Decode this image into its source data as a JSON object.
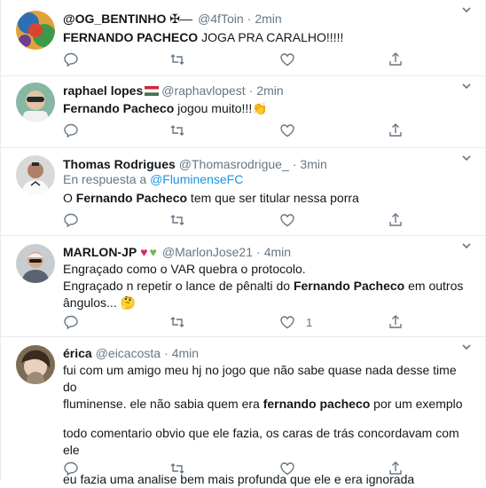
{
  "tweets": [
    {
      "name": "@OG_BENTINHO",
      "name_suffix": "✠—",
      "handle": "@4fToin",
      "time": "2min",
      "body_bold": "FERNANDO PACHECO",
      "body_rest": " JOGA PRA CARALHO!!!!!",
      "like_count": ""
    },
    {
      "name": "raphael lopes",
      "handle": "@raphavlopest",
      "time": "2min",
      "body_bold": "Fernando Pacheco",
      "body_rest": " jogou muito!!!",
      "body_emoji": "👏",
      "like_count": ""
    },
    {
      "name": "Thomas Rodrigues",
      "handle": "@Thomasrodrigue_",
      "time": "3min",
      "reply_prefix": "En respuesta a",
      "reply_to": "@FluminenseFC",
      "body_pre": "O ",
      "body_bold": "Fernando Pacheco",
      "body_rest": " tem que ser titular nessa porra",
      "like_count": ""
    },
    {
      "name": "MARLON-JP",
      "handle": "@MarlonJose21",
      "time": "4min",
      "line1": "Engraçado como o VAR quebra o protocolo.",
      "line2_pre": "Engraçado n repetir o lance de pênalti do ",
      "line2_bold": "Fernando Pacheco",
      "line2_rest": " em outros",
      "line3": "ângulos... ",
      "line3_emoji": "🤔",
      "like_count": "1"
    },
    {
      "name": "érica",
      "handle": "@eicacosta",
      "time": "4min",
      "line1": "fui com um amigo meu hj no jogo que não sabe quase nada desse time do",
      "line2_pre": "fluminense. ele não sabia quem era ",
      "line2_bold": "fernando pacheco",
      "line2_rest": " por um exemplo",
      "line3": "todo comentario obvio que ele fazia, os caras de trás concordavam com ele",
      "line4": "eu fazia uma analise bem mais profunda que ele e era ignorada",
      "like_count": ""
    }
  ],
  "icons": {
    "reply": "reply-icon",
    "retweet": "retweet-icon",
    "like": "like-icon",
    "share": "share-icon",
    "caret": "chevron-down-icon"
  },
  "colors": {
    "link": "#1b95e0",
    "muted": "#657786",
    "text": "#14171a",
    "divider": "#e6ecf0"
  }
}
